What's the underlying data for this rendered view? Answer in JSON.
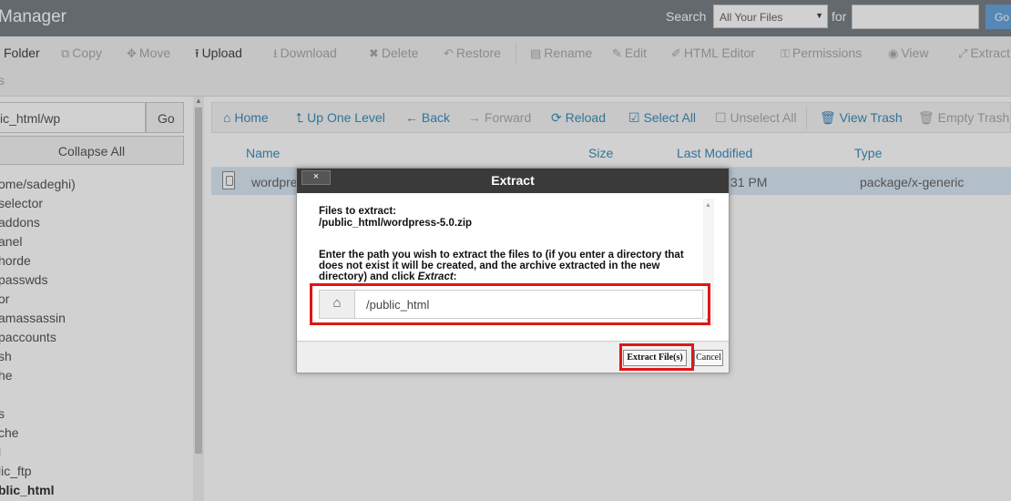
{
  "header": {
    "title": "Manager",
    "search_label": "Search",
    "search_scope": "All Your Files",
    "for_label": "for",
    "search_value": "",
    "go_label": "Go"
  },
  "toolbar": {
    "folder": "Folder",
    "copy": "Copy",
    "move": "Move",
    "upload": "Upload",
    "download": "Download",
    "delete": "Delete",
    "restore": "Restore",
    "rename": "Rename",
    "edit": "Edit",
    "html_editor": "HTML Editor",
    "permissions": "Permissions",
    "view": "View",
    "extract": "Extract",
    "row2": "s"
  },
  "sidebar": {
    "path_value": "ic_html/wp",
    "go_label": "Go",
    "collapse_label": "Collapse All",
    "tree": [
      "ome/sadeghi)",
      "selector",
      "addons",
      "anel",
      "horde",
      "passwds",
      "or",
      "amassassin",
      "paccounts",
      "sh",
      "he",
      "",
      "s",
      "che",
      "l",
      "lic_ftp",
      "blic_html"
    ]
  },
  "nav": {
    "home": "Home",
    "up_one_level": "Up One Level",
    "back": "Back",
    "forward": "Forward",
    "reload": "Reload",
    "select_all": "Select All",
    "unselect_all": "Unselect All",
    "view_trash": "View Trash",
    "empty_trash": "Empty Trash"
  },
  "table": {
    "headers": [
      "Name",
      "Size",
      "Last Modified",
      "Type"
    ],
    "rows": [
      {
        "name": "wordpre",
        "modified": "31 PM",
        "type": "package/x-generic"
      }
    ]
  },
  "dialog": {
    "title": "Extract",
    "close": "×",
    "files_label": "Files to extract:",
    "file_path": "/public_html/wordpress-5.0.zip",
    "instructions": "Enter the path you wish to extract the files to (if you enter a directory that does not exist it will be created, and the archive extracted in the new directory) and click",
    "instructions_em": "Extract",
    "instructions_end": ":",
    "path_value": "/public_html",
    "extract_button": "Extract File(s)",
    "cancel_button": "Cancel"
  },
  "colors": {
    "header_bg": "#7b8087",
    "link": "#3c8dbc",
    "highlight": "#e01616",
    "selected_row": "#d9e8f4"
  }
}
